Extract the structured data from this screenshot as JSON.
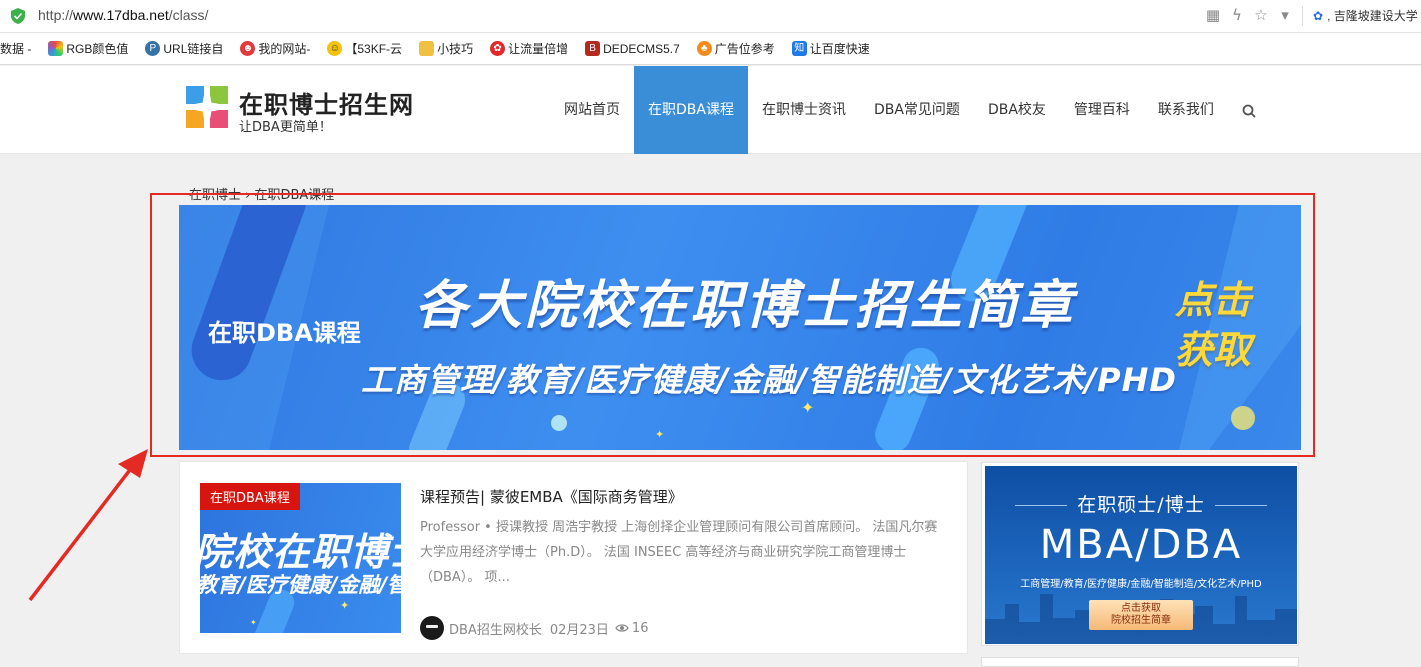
{
  "browser": {
    "url_prefix": "http://",
    "url_host": "www.17dba.net",
    "url_path": "/class/",
    "search_hint": "吉隆坡建设大学"
  },
  "bookmarks": [
    {
      "label": "数据 -",
      "color": "#ffffff"
    },
    {
      "label": "RGB颜色值",
      "color": "#e85c9c"
    },
    {
      "label": "URL链接自",
      "color": "#3572a5"
    },
    {
      "label": "我的网站-",
      "color": "#e23b3b"
    },
    {
      "label": "【53KF-云",
      "color": "#f2c20f"
    },
    {
      "label": "小技巧",
      "color": "#f0c040"
    },
    {
      "label": "让流量倍增",
      "color": "#e4282a"
    },
    {
      "label": "DEDECMS5.7",
      "color": "#b42a1e"
    },
    {
      "label": "广告位参考",
      "color": "#f08b1c"
    },
    {
      "label": "让百度快速",
      "color": "#1f7ae6"
    }
  ],
  "site": {
    "title": "在职博士招生网",
    "slogan": "让DBA更简单！"
  },
  "nav": [
    {
      "label": "网站首页",
      "active": false
    },
    {
      "label": "在职DBA课程",
      "active": true
    },
    {
      "label": "在职博士资讯",
      "active": false
    },
    {
      "label": "DBA常见问题",
      "active": false
    },
    {
      "label": "DBA校友",
      "active": false
    },
    {
      "label": "管理百科",
      "active": false
    },
    {
      "label": "联系我们",
      "active": false
    }
  ],
  "breadcrumb": "在职博士 › 在职DBA课程",
  "banner": {
    "tag": "在职DBA课程",
    "headline": "各大院校在职博士招生简章",
    "sub": "工商管理/教育/医疗健康/金融/智能制造/文化艺术/PHD",
    "cta_line1": "点击",
    "cta_line2": "获取"
  },
  "article": {
    "badge": "在职DBA课程",
    "thumb_line1": "院校在职博士",
    "thumb_line2": "教育/医疗健康/金融/智能",
    "title": "课程预告| 蒙彼EMBA《国际商务管理》",
    "excerpt": "Professor • 授课教授 周浩宇教授 上海创择企业管理顾问有限公司首席顾问。 法国凡尔赛大学应用经济学博士（Ph.D）。 法国 INSEEC 高等经济与商业研究学院工商管理博士（DBA）。 项...",
    "author": "DBA招生网校长",
    "date": "02月23日",
    "views": "16"
  },
  "side_ad": {
    "line1": "在职硕士/博士",
    "line2": "MBA/DBA",
    "line3": "工商管理/教育/医疗健康/金融/智能制造/文化艺术/PHD",
    "button_line1": "点击获取",
    "button_line2": "院校招生简章"
  },
  "colors": {
    "accent_nav": "#3a8ed8",
    "badge_red": "#d7140e",
    "annotation_red": "#e32b23",
    "cta_yellow": "#ffd93a"
  }
}
